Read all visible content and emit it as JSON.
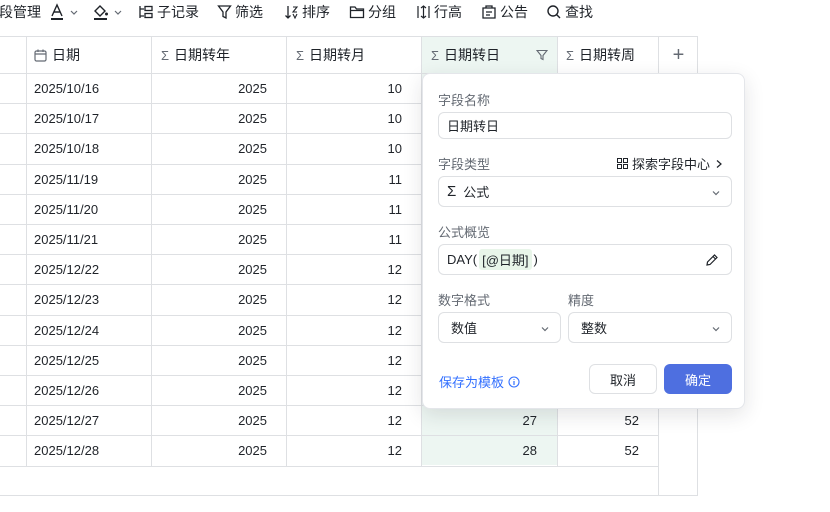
{
  "toolbar": {
    "field_mgmt_label": "段管理",
    "record_label": "子记录",
    "filter_label": "筛选",
    "sort_label": "排序",
    "group_label": "分组",
    "row_height_label": "行高",
    "announce_label": "公告",
    "search_label": "查找"
  },
  "table": {
    "columns": [
      {
        "label": "日期",
        "icon": "calendar-icon"
      },
      {
        "label": "日期转年",
        "icon": "sigma-icon"
      },
      {
        "label": "日期转月",
        "icon": "sigma-icon"
      },
      {
        "label": "日期转日",
        "icon": "sigma-icon"
      },
      {
        "label": "日期转周",
        "icon": "sigma-icon"
      }
    ],
    "add_column_label": "+",
    "rows": [
      {
        "date": "2025/10/16",
        "year": "2025",
        "month": "10"
      },
      {
        "date": "2025/10/17",
        "year": "2025",
        "month": "10"
      },
      {
        "date": "2025/10/18",
        "year": "2025",
        "month": "10"
      },
      {
        "date": "2025/11/19",
        "year": "2025",
        "month": "11"
      },
      {
        "date": "2025/11/20",
        "year": "2025",
        "month": "11"
      },
      {
        "date": "2025/11/21",
        "year": "2025",
        "month": "11"
      },
      {
        "date": "2025/12/22",
        "year": "2025",
        "month": "12"
      },
      {
        "date": "2025/12/23",
        "year": "2025",
        "month": "12"
      },
      {
        "date": "2025/12/24",
        "year": "2025",
        "month": "12"
      },
      {
        "date": "2025/12/25",
        "year": "2025",
        "month": "12"
      },
      {
        "date": "2025/12/26",
        "year": "2025",
        "month": "12"
      },
      {
        "date": "2025/12/27",
        "year": "2025",
        "month": "12",
        "day": "27",
        "week": "52"
      },
      {
        "date": "2025/12/28",
        "year": "2025",
        "month": "12",
        "day": "28",
        "week": "52"
      }
    ]
  },
  "panel": {
    "field_name_label": "字段名称",
    "field_name_value": "日期转日",
    "field_type_label": "字段类型",
    "explore_label": "探索字段中心",
    "field_type_value": "公式",
    "formula_label": "公式概览",
    "formula_prefix": "DAY(",
    "formula_token": "[@日期]",
    "formula_suffix": ")",
    "number_format_label": "数字格式",
    "number_format_value": "数值",
    "precision_label": "精度",
    "precision_value": "整数",
    "save_template_label": "保存为模板",
    "cancel_label": "取消",
    "confirm_label": "确定",
    "accent_color": "#3370ff"
  }
}
